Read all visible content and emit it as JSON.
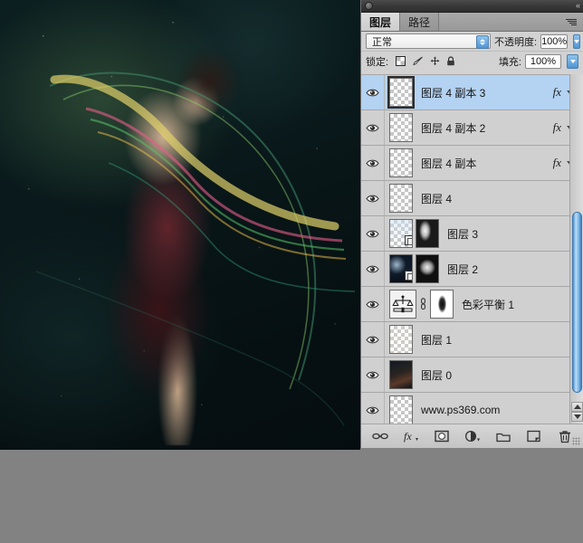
{
  "app": {
    "title_bar": {
      "collapse_label": "«"
    }
  },
  "panel": {
    "tabs": [
      {
        "id": "layers",
        "label": "图层",
        "active": true
      },
      {
        "id": "paths",
        "label": "路径",
        "active": false
      }
    ],
    "menu_icon": "panel-menu-icon",
    "blend_mode": {
      "value": "正常",
      "label": "blend-mode"
    },
    "opacity": {
      "label": "不透明度:",
      "value": "100%"
    },
    "lock": {
      "label": "锁定:",
      "icons": [
        "lock-transparent-pixels-icon",
        "lock-image-pixels-icon",
        "lock-position-icon",
        "lock-all-icon"
      ]
    },
    "fill": {
      "label": "填充:",
      "value": "100%"
    }
  },
  "layers": [
    {
      "name": "图层 4 副本 3",
      "selected": true,
      "visible": true,
      "thumb": "checker",
      "fx": true,
      "mask": false,
      "linked": false
    },
    {
      "name": "图层 4 副本 2",
      "selected": false,
      "visible": true,
      "thumb": "checker",
      "fx": true,
      "mask": false,
      "linked": false
    },
    {
      "name": "图层 4 副本",
      "selected": false,
      "visible": true,
      "thumb": "checker",
      "fx": true,
      "mask": false,
      "linked": false
    },
    {
      "name": "图层 4",
      "selected": false,
      "visible": true,
      "thumb": "checker",
      "fx": false,
      "mask": false,
      "linked": false
    },
    {
      "name": "图层 3",
      "selected": false,
      "visible": true,
      "thumb": "checker-light",
      "fx": false,
      "mask": true,
      "linked": true
    },
    {
      "name": "图层 2",
      "selected": false,
      "visible": true,
      "thumb": "space",
      "fx": false,
      "mask": true,
      "linked": true
    },
    {
      "name": "色彩平衡 1",
      "selected": false,
      "visible": true,
      "thumb": "adjustment-color-balance",
      "fx": false,
      "mask": true,
      "linked": true
    },
    {
      "name": "图层 1",
      "selected": false,
      "visible": true,
      "thumb": "checker-faint",
      "fx": false,
      "mask": false,
      "linked": false
    },
    {
      "name": "图层 0",
      "selected": false,
      "visible": true,
      "thumb": "photo",
      "fx": false,
      "mask": false,
      "linked": false
    },
    {
      "name": "www.ps369.com",
      "selected": false,
      "visible": true,
      "thumb": "checker",
      "fx": false,
      "mask": false,
      "linked": false
    }
  ],
  "footer_buttons": [
    {
      "id": "link-layers",
      "icon": "link-icon"
    },
    {
      "id": "layer-style",
      "icon": "fx-icon"
    },
    {
      "id": "add-layer-mask",
      "icon": "layer-mask-icon"
    },
    {
      "id": "new-fill-adjust",
      "icon": "adjustment-layer-icon"
    },
    {
      "id": "new-group",
      "icon": "folder-icon"
    },
    {
      "id": "new-layer",
      "icon": "new-layer-icon"
    },
    {
      "id": "delete-layer",
      "icon": "trash-icon"
    }
  ],
  "colors": {
    "selection_blue": "#b4d2f2",
    "panel_gray": "#d3d3d3",
    "desktop_gray": "#828282",
    "scrollbar_blue": "#4b8fd0"
  },
  "canvas": {
    "alt": "dancing-woman-cosmic-artwork"
  }
}
